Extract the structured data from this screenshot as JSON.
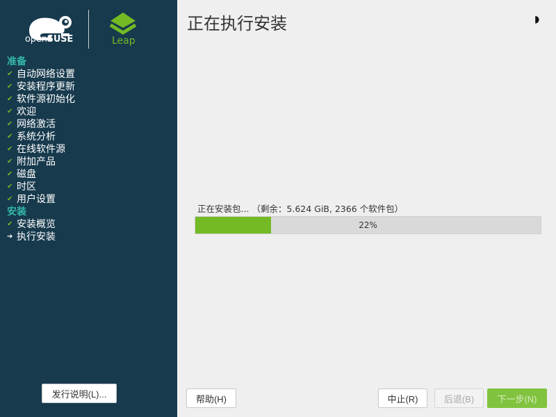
{
  "colors": {
    "sidebar_bg": "#173a4d",
    "accent_green": "#73ba25",
    "group_title": "#35b9ab",
    "main_bg": "#efefef"
  },
  "branding": {
    "opensuse_prefix": "open",
    "opensuse_suffix": "SUSE",
    "leap_label": "Leap"
  },
  "sidebar": {
    "groups": [
      {
        "title": "准备",
        "steps": [
          {
            "label": "自动网络设置",
            "status": "done"
          },
          {
            "label": "安装程序更新",
            "status": "done"
          },
          {
            "label": "软件源初始化",
            "status": "done"
          },
          {
            "label": "欢迎",
            "status": "done"
          },
          {
            "label": "网络激活",
            "status": "done"
          },
          {
            "label": "系统分析",
            "status": "done"
          },
          {
            "label": "在线软件源",
            "status": "done"
          },
          {
            "label": "附加产品",
            "status": "done"
          },
          {
            "label": "磁盘",
            "status": "done"
          },
          {
            "label": "时区",
            "status": "done"
          },
          {
            "label": "用户设置",
            "status": "done"
          }
        ]
      },
      {
        "title": "安装",
        "steps": [
          {
            "label": "安装概览",
            "status": "done"
          },
          {
            "label": "执行安装",
            "status": "current"
          }
        ]
      }
    ],
    "release_notes_button": "发行说明(L)..."
  },
  "main": {
    "title": "正在执行安装",
    "theme_toggle_icon": "half-moon-icon",
    "progress": {
      "label": "正在安装包... （剩余：5.624 GiB, 2366 个软件包）",
      "percent": 22,
      "percent_text": "22%"
    }
  },
  "footer": {
    "help_label": "帮助(H)",
    "abort_label": "中止(R)",
    "back_label": "后退(B)",
    "next_label": "下一步(N)"
  }
}
